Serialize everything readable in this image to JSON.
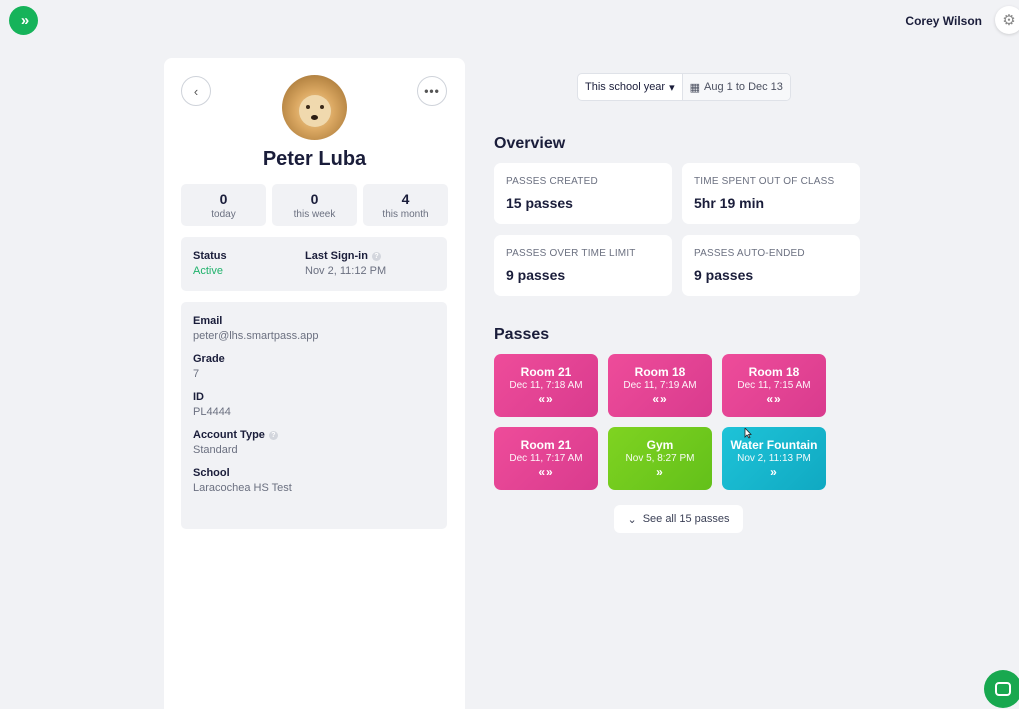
{
  "app": {
    "logo_glyph": "»",
    "user_name": "Corey Wilson",
    "settings_icon": "⚙"
  },
  "profile": {
    "name": "Peter Luba",
    "back_glyph": "‹",
    "more_glyph": "•••",
    "stats": [
      {
        "value": "0",
        "label": "today"
      },
      {
        "value": "0",
        "label": "this week"
      },
      {
        "value": "4",
        "label": "this month"
      }
    ],
    "status": {
      "title": "Status",
      "value": "Active"
    },
    "last_signin": {
      "title": "Last Sign-in",
      "value": "Nov 2, 11:12 PM"
    },
    "help_glyph": "?",
    "details": [
      {
        "title": "Email",
        "value": "peter@lhs.smartpass.app",
        "help": false
      },
      {
        "title": "Grade",
        "value": "7",
        "help": false
      },
      {
        "title": "ID",
        "value": "PL4444",
        "help": false
      },
      {
        "title": "Account Type",
        "value": "Standard",
        "help": true
      },
      {
        "title": "School",
        "value": "Laracochea HS Test",
        "help": false
      }
    ]
  },
  "filter": {
    "period": "This school year",
    "period_caret": "▾",
    "calendar_glyph": "▦",
    "range": "Aug 1 to Dec 13"
  },
  "overview": {
    "title": "Overview",
    "cards": [
      {
        "label": "PASSES CREATED",
        "value": "15 passes"
      },
      {
        "label": "TIME SPENT OUT OF CLASS",
        "value": "5hr 19 min"
      },
      {
        "label": "PASSES OVER TIME LIMIT",
        "value": "9 passes"
      },
      {
        "label": "PASSES AUTO-ENDED",
        "value": "9 passes"
      }
    ]
  },
  "passes": {
    "title": "Passes",
    "items": [
      {
        "name": "Room 21",
        "time": "Dec 11, 7:18 AM",
        "arrows": "«»",
        "color": "pink"
      },
      {
        "name": "Room 18",
        "time": "Dec 11, 7:19 AM",
        "arrows": "«»",
        "color": "pink"
      },
      {
        "name": "Room 18",
        "time": "Dec 11, 7:15 AM",
        "arrows": "«»",
        "color": "pink"
      },
      {
        "name": "Room 21",
        "time": "Dec 11, 7:17 AM",
        "arrows": "«»",
        "color": "pink"
      },
      {
        "name": "Gym",
        "time": "Nov 5, 8:27 PM",
        "arrows": "»",
        "color": "green"
      },
      {
        "name": "Water Fountain",
        "time": "Nov 2, 11:13 PM",
        "arrows": "»",
        "color": "teal"
      }
    ],
    "see_all_glyph": "⌄",
    "see_all": "See all 15 passes"
  },
  "colors": {
    "pink": "#e4448f",
    "green": "#6ec71d",
    "teal": "#17b6cd",
    "brand": "#16b35a"
  }
}
